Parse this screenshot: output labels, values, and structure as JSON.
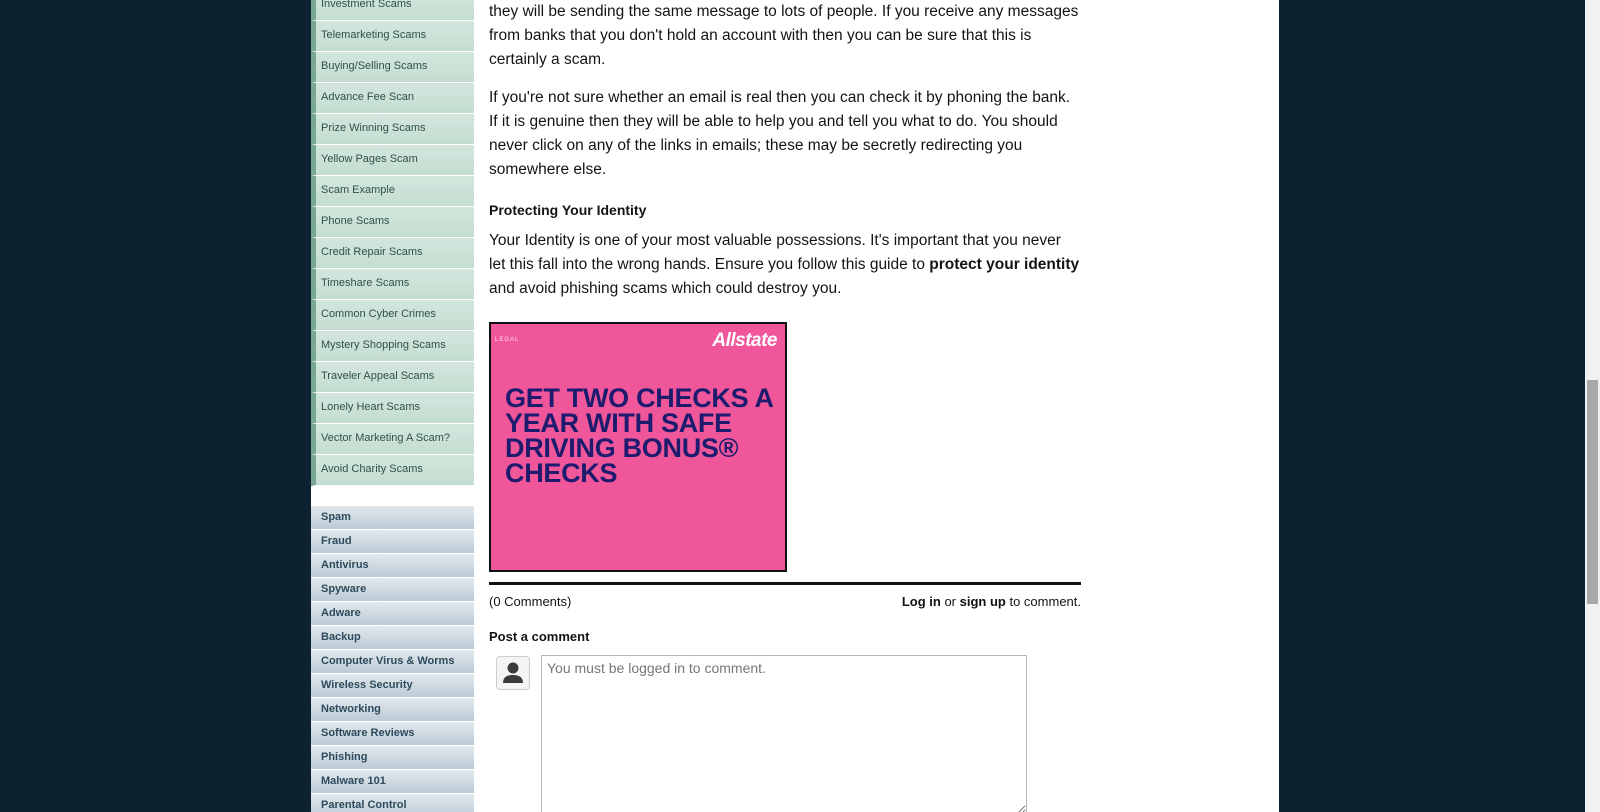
{
  "sidebar": {
    "sub_items": [
      {
        "label": "Investment Scams"
      },
      {
        "label": "Telemarketing Scams"
      },
      {
        "label": "Buying/Selling Scams"
      },
      {
        "label": "Advance Fee Scan"
      },
      {
        "label": "Prize Winning Scams"
      },
      {
        "label": "Yellow Pages Scam"
      },
      {
        "label": "Scam Example"
      },
      {
        "label": "Phone Scams"
      },
      {
        "label": "Credit Repair Scams"
      },
      {
        "label": "Timeshare Scams"
      },
      {
        "label": "Common Cyber Crimes"
      },
      {
        "label": "Mystery Shopping Scams"
      },
      {
        "label": "Traveler Appeal Scams"
      },
      {
        "label": "Lonely Heart Scams"
      },
      {
        "label": "Vector Marketing A Scam?"
      },
      {
        "label": "Avoid Charity Scams"
      }
    ],
    "categories": [
      {
        "label": "Spam"
      },
      {
        "label": "Fraud"
      },
      {
        "label": "Antivirus"
      },
      {
        "label": "Spyware"
      },
      {
        "label": "Adware"
      },
      {
        "label": "Backup"
      },
      {
        "label": "Computer Virus & Worms"
      },
      {
        "label": "Wireless Security"
      },
      {
        "label": "Networking"
      },
      {
        "label": "Software Reviews"
      },
      {
        "label": "Phishing"
      },
      {
        "label": "Malware 101"
      },
      {
        "label": "Parental Control"
      }
    ]
  },
  "article": {
    "para1": "they will be sending the same message to lots of people. If you receive any messages from banks that you don't hold an account with then you can be sure that this is certainly a scam.",
    "para2": "If you're not sure whether an email is real then you can check it by phoning the bank. If it is genuine then they will be able to help you and tell you what to do. You should never click on any of the links in emails; these may be secretly redirecting you somewhere else.",
    "identity_heading": "Protecting Your Identity",
    "para3_before": "Your Identity is one of your most valuable possessions. It's important that you never let this fall into the wrong hands. Ensure you follow this guide to ",
    "para3_bold": "protect your identity",
    "para3_after": " and avoid phishing scams which could destroy you."
  },
  "ad": {
    "legal": "LEGAL",
    "brand": "Allstate",
    "headline": "GET TWO CHECKS A YEAR WITH SAFE DRIVING BONUS® CHECKS",
    "background": "#f0579a",
    "text_color": "#1d1b6e"
  },
  "comments": {
    "count": "(0 Comments)",
    "login_label": "Log in",
    "or_text": " or ",
    "signup_label": "sign up",
    "to_comment": " to comment.",
    "post_heading": "Post a comment",
    "placeholder": "You must be logged in to comment."
  },
  "icons": {
    "avatar": "user-silhouette-icon"
  }
}
